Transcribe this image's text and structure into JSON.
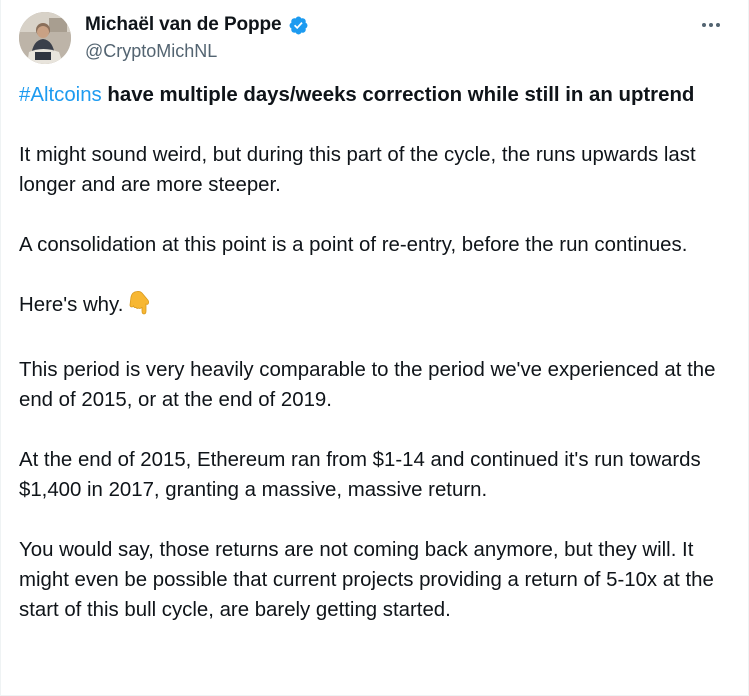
{
  "author": {
    "display_name": "Michaël van de Poppe",
    "handle": "@CryptoMichNL",
    "verified": true,
    "verified_color": "#1d9bf0"
  },
  "icons": {
    "more": "more-horizontal-icon",
    "verified": "verified-badge-icon",
    "emoji": "backhand-index-pointing-down"
  },
  "tweet": {
    "hashtag": "#Altcoins",
    "headline_rest": " have multiple days/weeks correction while still in an uptrend",
    "paragraphs": [
      "It might sound weird, but during this part of the cycle, the runs upwards last longer and are more steeper.",
      "A consolidation at this point is a point of re-entry, before the run continues.",
      "Here's why.",
      "This period is very heavily comparable to the period we've experienced at the end of 2015, or at the end of 2019.",
      "At the end of 2015, Ethereum ran from $1-14 and continued it's run towards $1,400 in 2017, granting a massive, massive return.",
      "You would say, those returns are not coming back anymore, but they will. It might even be possible that current projects providing a return of 5-10x at the start of this bull cycle, are barely getting started."
    ]
  },
  "colors": {
    "link": "#1d9bf0",
    "text": "#0f1419",
    "secondary": "#536471"
  }
}
